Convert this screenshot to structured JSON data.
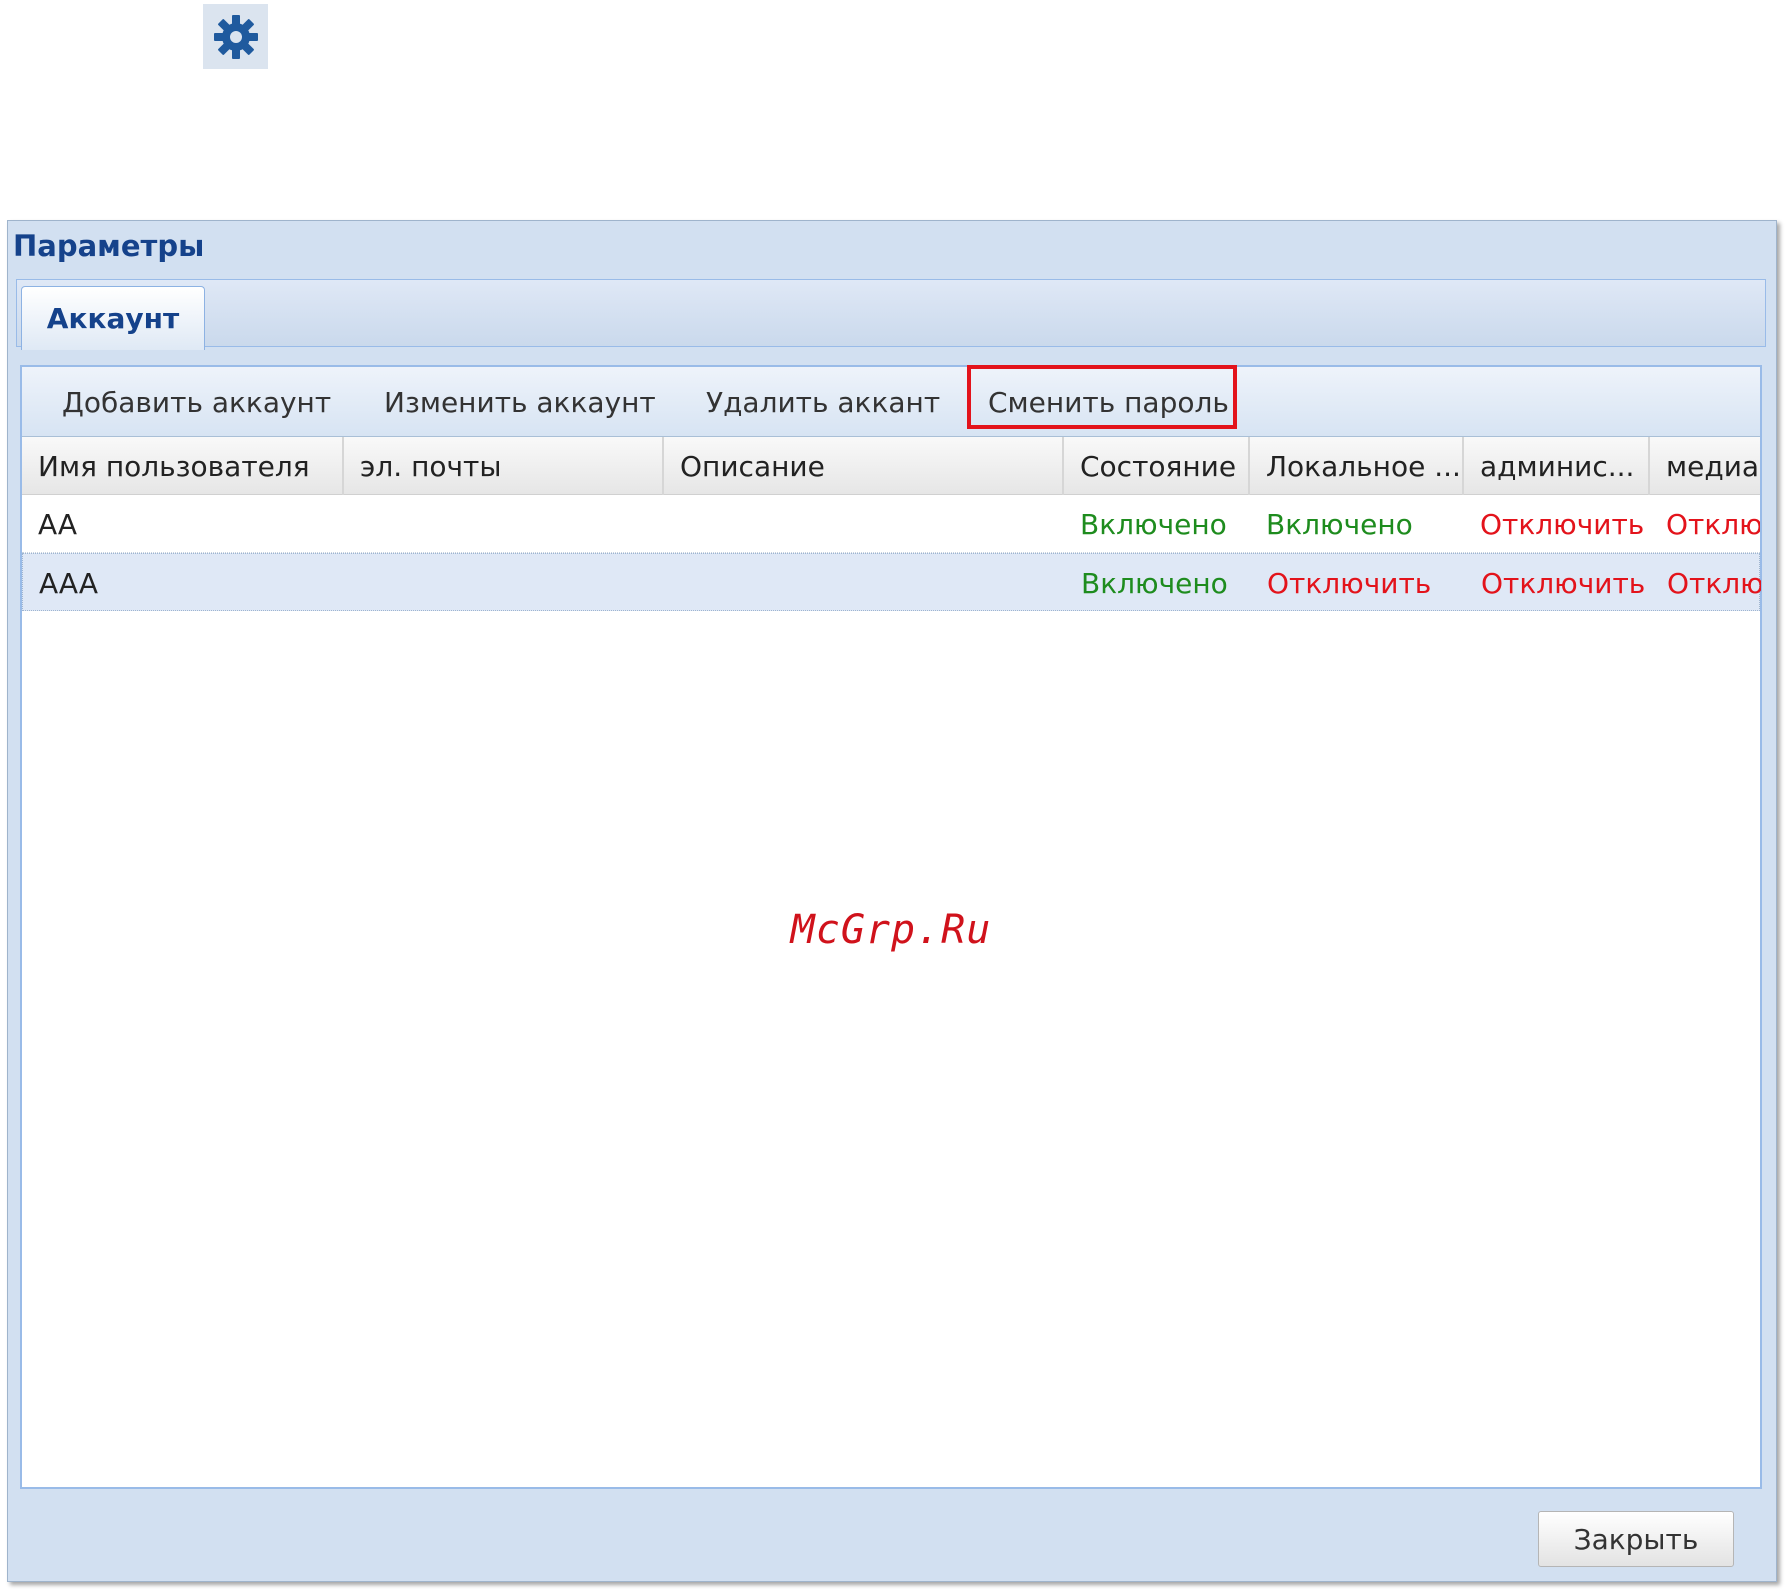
{
  "settings_icon": "gear-icon",
  "dialog": {
    "title": "Параметры",
    "tab": "Аккаунт"
  },
  "toolbar": {
    "add_label": "Добавить аккаунт",
    "edit_label": "Изменить аккаунт",
    "delete_label": "Удалить аккант",
    "change_password_label": "Сменить пароль"
  },
  "table": {
    "columns": [
      "Имя пользователя",
      "эл. почты",
      "Описание",
      "Состояние",
      "Локальное ...",
      "админис...",
      "медиа-"
    ],
    "rows": [
      {
        "username": "AA",
        "email": "",
        "description": "",
        "state": "Включено",
        "local": "Включено",
        "admin": "Отключить",
        "media": "Отклю"
      },
      {
        "username": "AAA",
        "email": "",
        "description": "",
        "state": "Включено",
        "local": "Отключить",
        "admin": "Отключить",
        "media": "Отклю"
      }
    ]
  },
  "watermark": "McGrp.Ru",
  "close_label": "Закрыть",
  "colors": {
    "enabled": "#1e8c1e",
    "disabled": "#e3131b",
    "title": "#15428b",
    "highlight": "#e3131b"
  }
}
